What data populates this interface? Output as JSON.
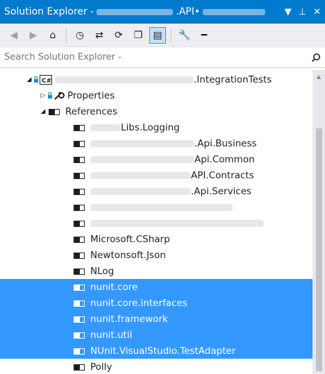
{
  "window": {
    "title_visible": "Solution Explorer - ",
    "title_mid": ".API",
    "title_tail": " • ",
    "controls": [
      "▼",
      "⊥",
      "✕"
    ],
    "control_names": [
      "dropdown-icon",
      "pin-icon",
      "close-icon"
    ]
  },
  "toolbar": {
    "buttons": [
      {
        "name": "back-icon",
        "glyph": "◀",
        "active": false
      },
      {
        "name": "forward-icon",
        "glyph": "▶",
        "active": false
      },
      {
        "name": "home-icon",
        "glyph": "⌂",
        "active": false
      },
      {
        "name": "pending-changes-icon",
        "glyph": "◷",
        "active": false
      },
      {
        "name": "sync-icon",
        "glyph": "⇄",
        "active": false
      },
      {
        "name": "refresh-icon",
        "glyph": "⟳",
        "active": false
      },
      {
        "name": "collapse-all-icon",
        "glyph": "❐",
        "active": false
      },
      {
        "name": "show-all-files-icon",
        "glyph": "▤",
        "active": true
      },
      {
        "name": "properties-icon",
        "glyph": "🔧",
        "active": false
      },
      {
        "name": "preview-icon",
        "glyph": "━",
        "active": false
      }
    ]
  },
  "search": {
    "placeholder": "Search Solution Explorer - ",
    "value": "Search Solution Explorer - "
  },
  "tree": {
    "project": {
      "label_suffix": ".IntegrationTests",
      "icon": "csharp-project-icon"
    },
    "properties_label": "Properties",
    "references_label": "References",
    "items": [
      {
        "prefix_blur": 44,
        "label": " Libs.Logging",
        "selected": false
      },
      {
        "prefix_blur": 150,
        "label": ".Api.Business",
        "selected": false
      },
      {
        "prefix_blur": 150,
        "label": " Api.Common",
        "selected": false
      },
      {
        "prefix_blur": 145,
        "label": " API.Contracts",
        "selected": false
      },
      {
        "prefix_blur": 145,
        "label": ".Api.Services",
        "selected": false
      },
      {
        "prefix_blur": 205,
        "label": "",
        "selected": false
      },
      {
        "prefix_blur": 250,
        "label": "",
        "selected": false
      },
      {
        "prefix_blur": 0,
        "label": "Microsoft.CSharp",
        "selected": false
      },
      {
        "prefix_blur": 0,
        "label": "Newtonsoft.Json",
        "selected": false
      },
      {
        "prefix_blur": 0,
        "label": "NLog",
        "selected": false
      },
      {
        "prefix_blur": 0,
        "label": "nunit.core",
        "selected": true
      },
      {
        "prefix_blur": 0,
        "label": "nunit.core.interfaces",
        "selected": true
      },
      {
        "prefix_blur": 0,
        "label": "nunit.framework",
        "selected": true
      },
      {
        "prefix_blur": 0,
        "label": "nunit.util",
        "selected": true
      },
      {
        "prefix_blur": 0,
        "label": "NUnit.VisualStudio.TestAdapter",
        "selected": true
      },
      {
        "prefix_blur": 0,
        "label": "Polly",
        "selected": false
      }
    ]
  },
  "colors": {
    "accent": "#007acc",
    "selection": "#3399ff",
    "toolbar_bg": "#eeeef2"
  }
}
